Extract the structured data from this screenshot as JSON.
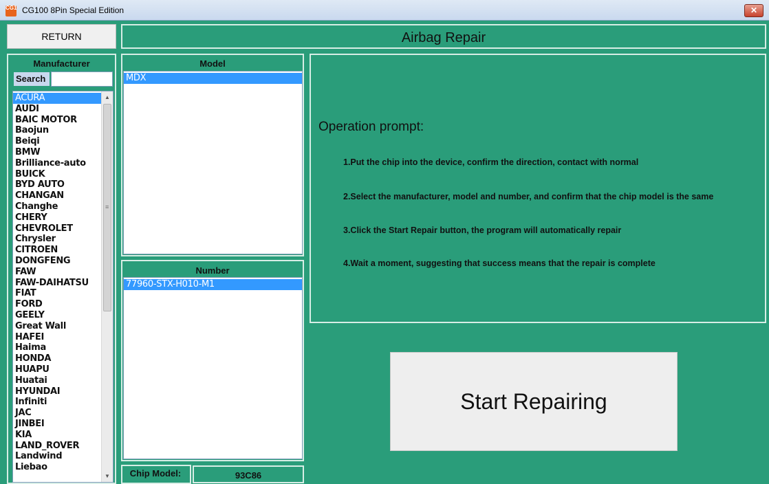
{
  "window": {
    "title": "CG100 8Pin Special Edition",
    "icon_text": "CG100",
    "close_icon": "close-x"
  },
  "toolbar": {
    "return_label": "RETURN",
    "page_title": "Airbag Repair"
  },
  "manufacturer": {
    "title": "Manufacturer",
    "search_label": "Search",
    "search_value": "",
    "items": [
      "ACURA",
      "AUDI",
      "BAIC MOTOR",
      "Baojun",
      "Beiqi",
      "BMW",
      "Brilliance-auto",
      "BUICK",
      "BYD AUTO",
      "CHANGAN",
      "Changhe",
      "CHERY",
      "CHEVROLET",
      "Chrysler",
      "CITROEN",
      "DONGFENG",
      "FAW",
      "FAW-DAIHATSU",
      "FIAT",
      "FORD",
      "GEELY",
      "Great Wall",
      "HAFEI",
      "Haima",
      "HONDA",
      "HUAPU",
      "Huatai",
      "HYUNDAI",
      "Infiniti",
      "JAC",
      "JINBEI",
      "KIA",
      "LAND_ROVER",
      "Landwind",
      "Liebao"
    ],
    "selected": "ACURA"
  },
  "model": {
    "title": "Model",
    "items": [
      "MDX"
    ],
    "selected": "MDX"
  },
  "number": {
    "title": "Number",
    "items": [
      "77960-STX-H010-M1"
    ],
    "selected": "77960-STX-H010-M1"
  },
  "chip": {
    "label": "Chip Model:",
    "value": "93C86"
  },
  "prompt": {
    "title": "Operation prompt:",
    "steps": [
      "1.Put the chip into the device, confirm the direction, contact with normal",
      "2.Select the manufacturer, model and number, and confirm that the chip model is the same",
      "3.Click the Start Repair button, the program will automatically repair",
      "4.Wait a moment, suggesting that success means that the repair is complete"
    ]
  },
  "start_button": {
    "label": "Start Repairing"
  },
  "colors": {
    "background": "#2a9d7a",
    "selection": "#3399ff",
    "border": "#d8eee6"
  }
}
